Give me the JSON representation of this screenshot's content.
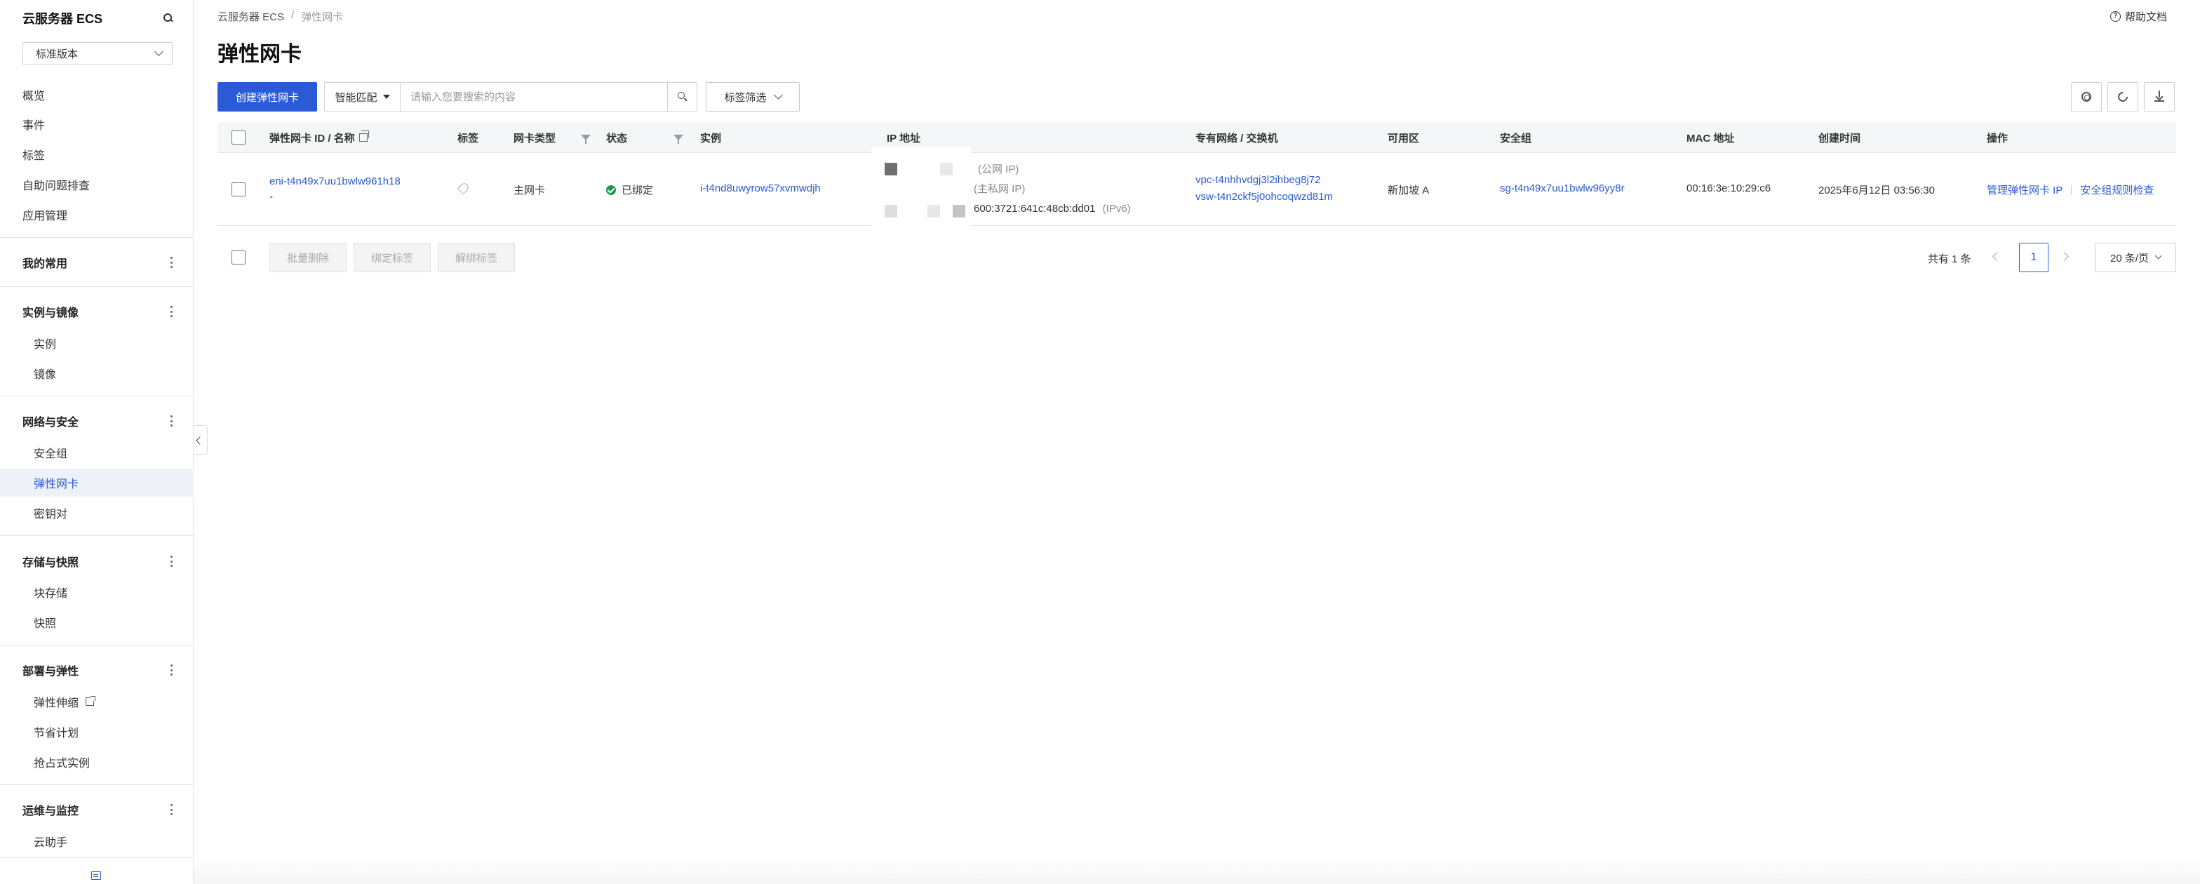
{
  "sidebar": {
    "title": "云服务器 ECS",
    "version": "标准版本",
    "top_items": [
      "概览",
      "事件",
      "标签",
      "自助问题排查",
      "应用管理"
    ],
    "favorites_label": "我的常用",
    "groups": [
      {
        "label": "实例与镜像",
        "items": [
          "实例",
          "镜像"
        ]
      },
      {
        "label": "网络与安全",
        "items": [
          "安全组",
          "弹性网卡",
          "密钥对"
        ]
      },
      {
        "label": "存储与快照",
        "items": [
          "块存储",
          "快照"
        ]
      },
      {
        "label": "部署与弹性",
        "items": [
          "弹性伸缩",
          "节省计划",
          "抢占式实例"
        ]
      },
      {
        "label": "运维与监控",
        "items": [
          "云助手"
        ]
      }
    ]
  },
  "breadcrumb": [
    "云服务器 ECS",
    "/",
    "弹性网卡"
  ],
  "help_label": "帮助文档",
  "page_title": "弹性网卡",
  "toolbar": {
    "create_label": "创建弹性网卡",
    "search_mode": "智能匹配",
    "search_placeholder": "请输入您要搜索的内容",
    "tag_filter": "标签筛选"
  },
  "table": {
    "headers": [
      "弹性网卡 ID / 名称",
      "标签",
      "网卡类型",
      "状态",
      "实例",
      "IP 地址",
      "专有网络 / 交换机",
      "可用区",
      "安全组",
      "MAC 地址",
      "创建时间",
      "操作"
    ],
    "row": {
      "eni_id": "eni-t4n49x7uu1bwlw961h18",
      "name": "-",
      "type": "主网卡",
      "status": "已绑定",
      "instance": "i-t4nd8uwyrow57xvmwdjh",
      "ip_public_label": "(公网 IP)",
      "ip_private_label": "(主私网 IP)",
      "ipv6": "600:3721:641c:48cb:dd01",
      "ipv6_label": "(IPv6)",
      "vpc": "vpc-t4nhhvdgj3l2ihbeg8j72",
      "vswitch": "vsw-t4n2ckf5j0ohcoqwzd81m",
      "zone": "新加坡 A",
      "security_group": "sg-t4n49x7uu1bwlw96yy8r",
      "mac": "00:16:3e:10:29:c6",
      "created": "2025年6月12日 03:56:30",
      "op_manage_ip": "管理弹性网卡 IP",
      "op_sg_check": "安全组规则检查"
    }
  },
  "footer": {
    "batch_delete": "批量删除",
    "bind_tag": "绑定标签",
    "unbind_tag": "解绑标签",
    "total": "共有 1 条",
    "page": "1",
    "page_size": "20 条/页"
  },
  "colors": {
    "primary": "#2a5bd7",
    "success": "#1a9b4b"
  }
}
